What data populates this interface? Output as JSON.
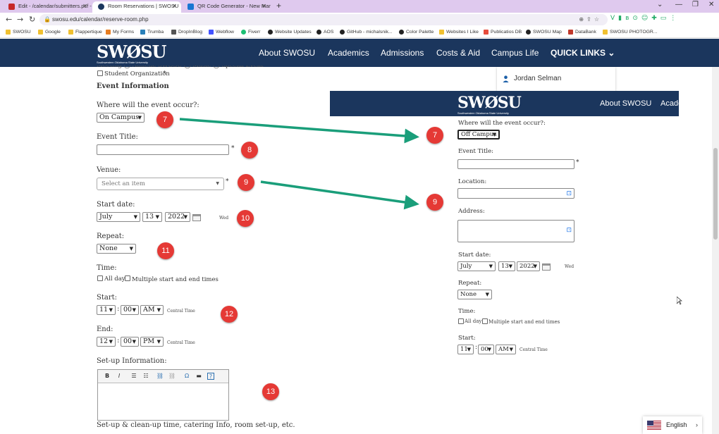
{
  "browser": {
    "tabs": [
      {
        "title": "Edit - /calendar/submitters.pcf -",
        "icon_color": "#c62828"
      },
      {
        "title": "Room Reservations | SWOSU",
        "icon_color": "#1b365d"
      },
      {
        "title": "QR Code Generator - New Man",
        "icon_color": "#1976d2"
      }
    ],
    "url": "swosu.edu/calendar/reserve-room.php",
    "bookmarks": [
      "SWOSU",
      "Google",
      "Flappertique",
      "My Forms",
      "Trumba",
      "DropInBlog",
      "Webflow",
      "Fiverr",
      "Website Updates",
      "AOS",
      "GitHub - michalsnik...",
      "Color Palette",
      "Websites I Like",
      "Publicatios DB",
      "SWOSU Map",
      "DataBank",
      "SWOSU PHOTOGR..."
    ]
  },
  "site": {
    "logo": "SWØSU",
    "logo_sub": "Southwestern Oklahoma State University",
    "nav": [
      "About SWOSU",
      "Academics",
      "Admissions",
      "Costs & Aid",
      "Campus Life"
    ],
    "quick_links": "QUICK LINKS ⌄",
    "user_name": "Jordan Selman"
  },
  "form": {
    "cut_off_line": "Meeting  ◯ Athletic SWOSU  ◯ Music  ◯ Special Event",
    "student_org": "Student Organization",
    "section_title": "Event Information",
    "where_label": "Where will the event occur?:",
    "where_value": "On Campus",
    "event_title_label": "Event Title:",
    "venue_label": "Venue:",
    "venue_placeholder": "Select an item",
    "start_date_label": "Start date:",
    "month": "July",
    "day": "13",
    "year": "2022",
    "weekday": "Wed",
    "repeat_label": "Repeat:",
    "repeat_value": "None",
    "time_label": "Time:",
    "all_day": "All day",
    "multiple_times": "Multiple start and end times",
    "start_label": "Start:",
    "start_hour": "11",
    "start_min": "00",
    "start_ampm": "AM",
    "end_label": "End:",
    "end_hour": "12",
    "end_min": "00",
    "end_ampm": "PM",
    "tz": "Central Time",
    "setup_label": "Set-up Information:",
    "setup_hint": "Set-up & clean-up time, catering Info, room set-up, etc.",
    "required": "*",
    "colon": ":"
  },
  "overlay": {
    "logo": "SWØSU",
    "logo_sub": "Southwestern Oklahoma State University",
    "nav_about": "About SWOSU",
    "nav_academics": "Acade",
    "where_label": "Where will the event occur?:",
    "where_value": "Off Campus",
    "event_title_label": "Event Title:",
    "location_label": "Location:",
    "address_label": "Address:",
    "start_date_label": "Start date:",
    "month": "July",
    "day": "13",
    "year": "2022",
    "weekday": "Wed",
    "repeat_label": "Repeat:",
    "repeat_value": "None",
    "time_label": "Time:",
    "all_day": "All day",
    "multiple_times": "Multiple start and end times",
    "start_label": "Start:",
    "start_hour": "11",
    "start_min": "00",
    "start_ampm": "AM",
    "tz": "Central Time"
  },
  "callouts": [
    "7",
    "8",
    "9",
    "10",
    "11",
    "12",
    "13",
    "7",
    "9"
  ],
  "language": "English",
  "colors": {
    "navy": "#1b365d",
    "badge": "#e53935",
    "arrow": "#1a9e7a"
  }
}
